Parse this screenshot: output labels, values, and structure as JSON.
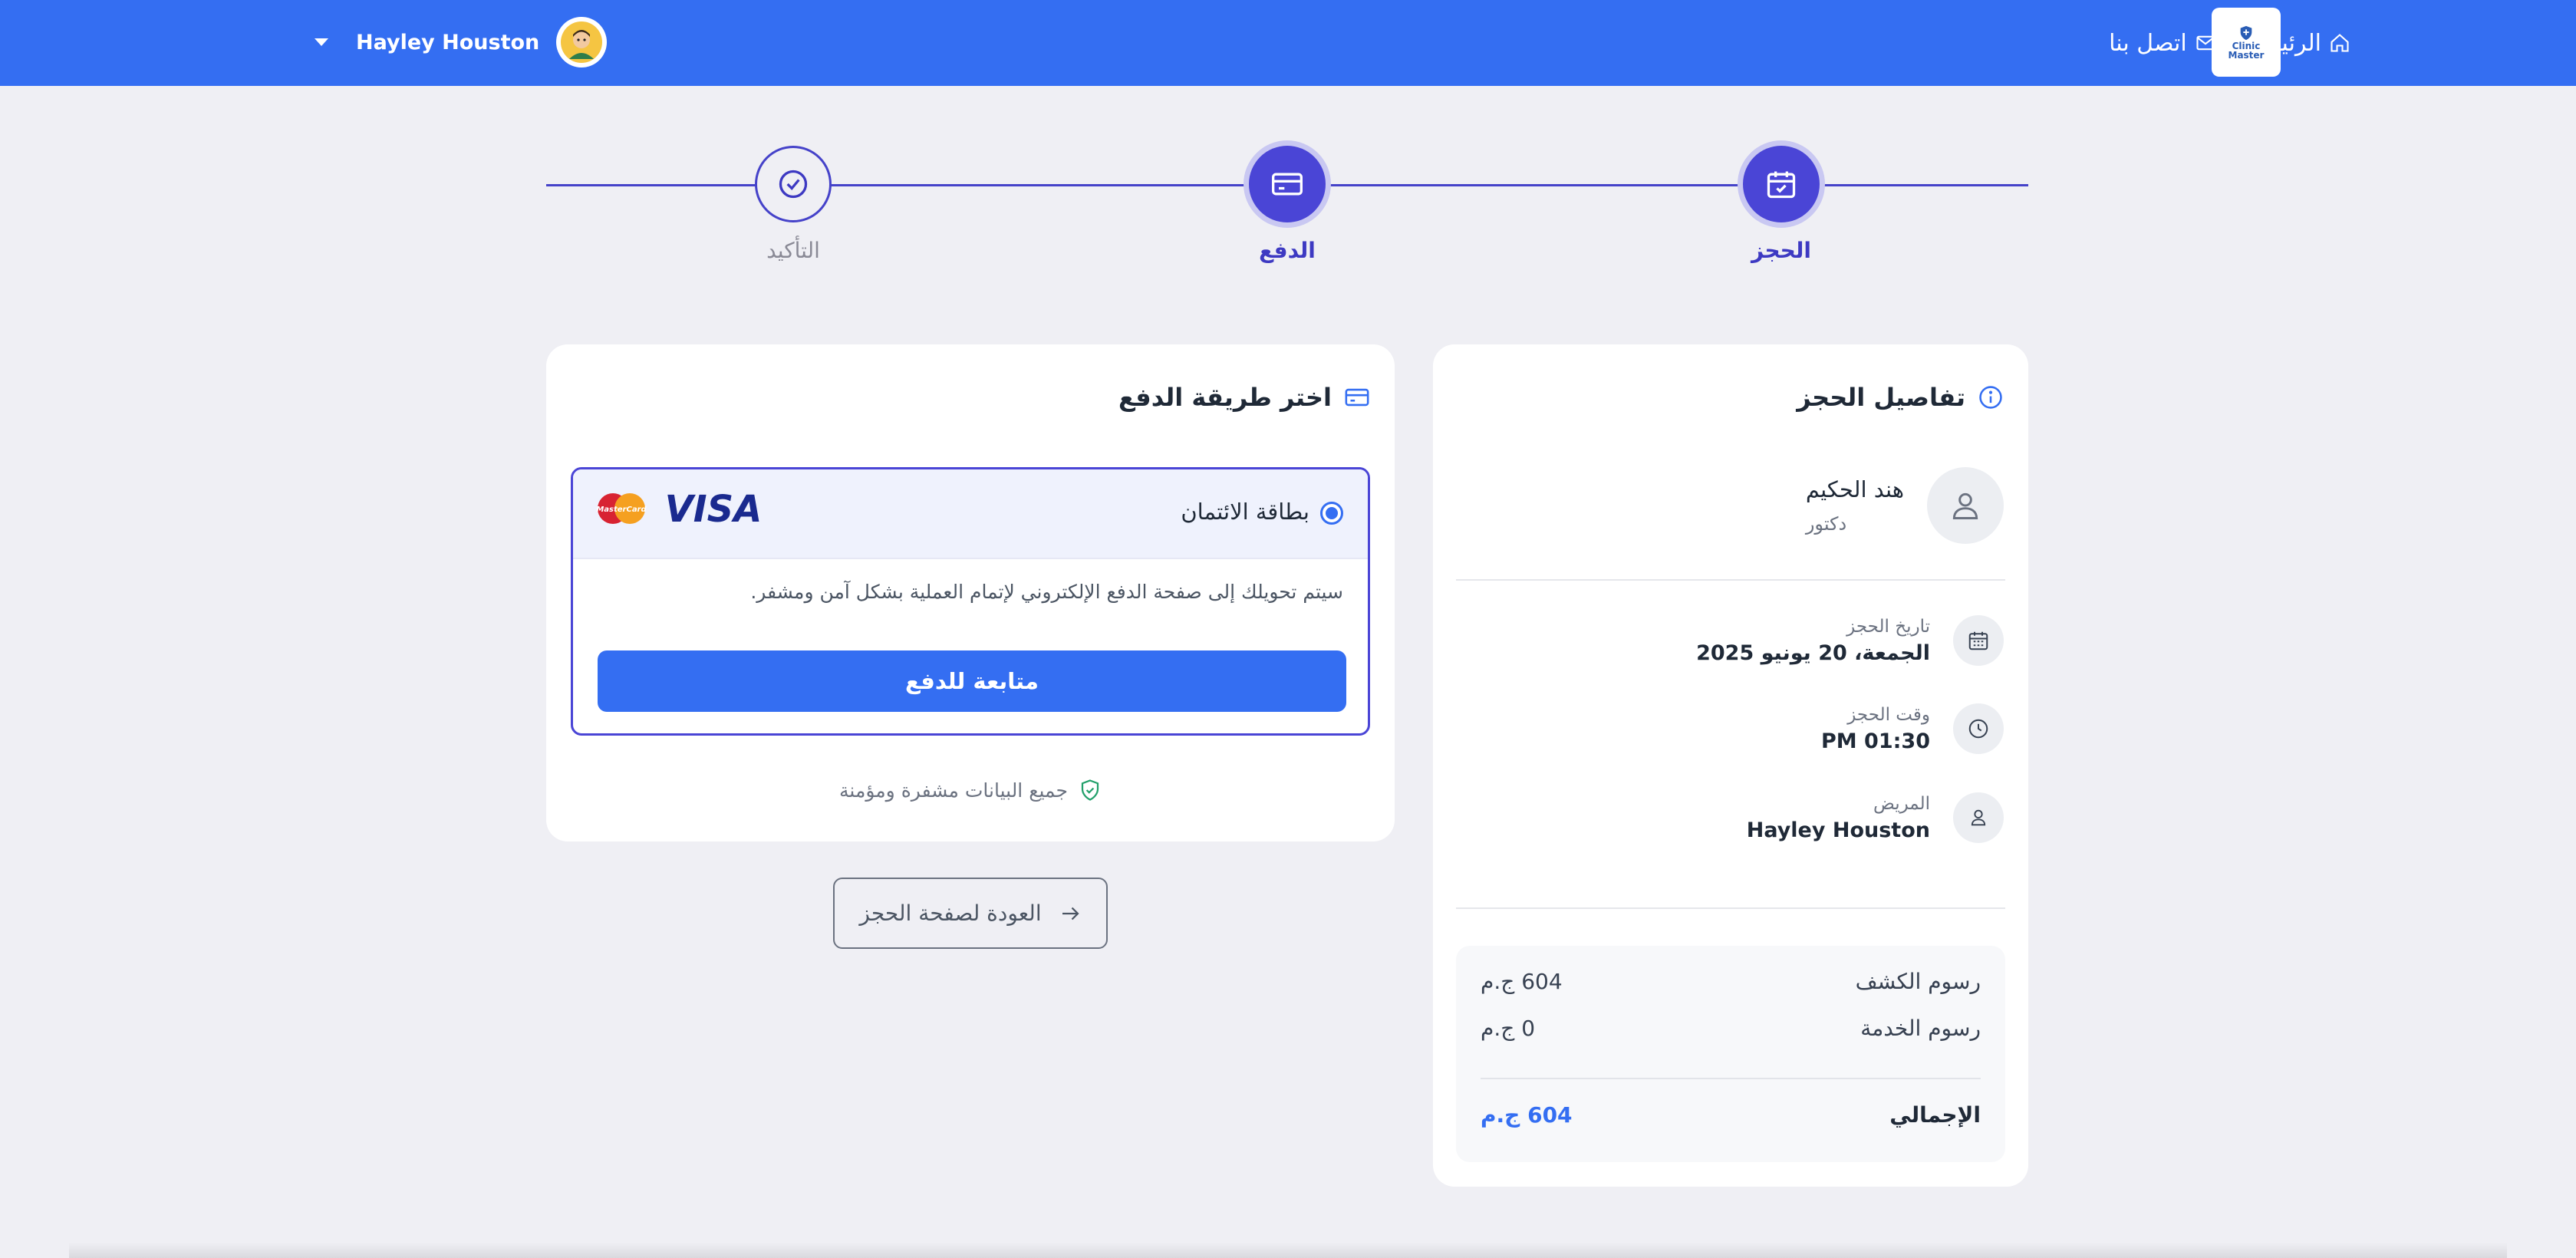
{
  "header": {
    "user_name": "Hayley Houston",
    "nav": {
      "home": "الرئيسية",
      "contact": "اتصل بنا"
    },
    "logo_text": [
      "Clinic",
      "Master"
    ],
    "brand_color": "#346ef2"
  },
  "stepper": {
    "steps": [
      {
        "label": "الحجز",
        "icon": "calendar-check-icon",
        "state": "active"
      },
      {
        "label": "الدفع",
        "icon": "credit-card-icon",
        "state": "active"
      },
      {
        "label": "التأكيد",
        "icon": "check-circle-icon",
        "state": "pending"
      }
    ]
  },
  "payment": {
    "title": "اختر طريقة الدفع",
    "method_label": "بطاقة الائتمان",
    "brands": [
      "VISA",
      "MasterCard"
    ],
    "description": "سيتم تحويلك إلى صفحة الدفع الإلكتروني لإتمام العملية بشكل آمن ومشفر.",
    "pay_button": "متابعة للدفع",
    "secure_note": "جميع البيانات مشفرة ومؤمنة",
    "back_button": "العودة لصفحة الحجز"
  },
  "booking": {
    "title": "تفاصيل الحجز",
    "doctor_name": "هند الحكيم",
    "doctor_role": "دكتور",
    "date_label": "تاريخ الحجز",
    "date_value": "الجمعة، 20 يونيو 2025",
    "time_label": "وقت الحجز",
    "time_value": "PM 01:30",
    "patient_label": "المريض",
    "patient_value": "Hayley Houston",
    "fees": {
      "exam_label": "رسوم الكشف",
      "exam_value": "604 ج.م",
      "service_label": "رسوم الخدمة",
      "service_value": "0 ج.م",
      "total_label": "الإجمالي",
      "total_value": "604 ج.م"
    }
  }
}
